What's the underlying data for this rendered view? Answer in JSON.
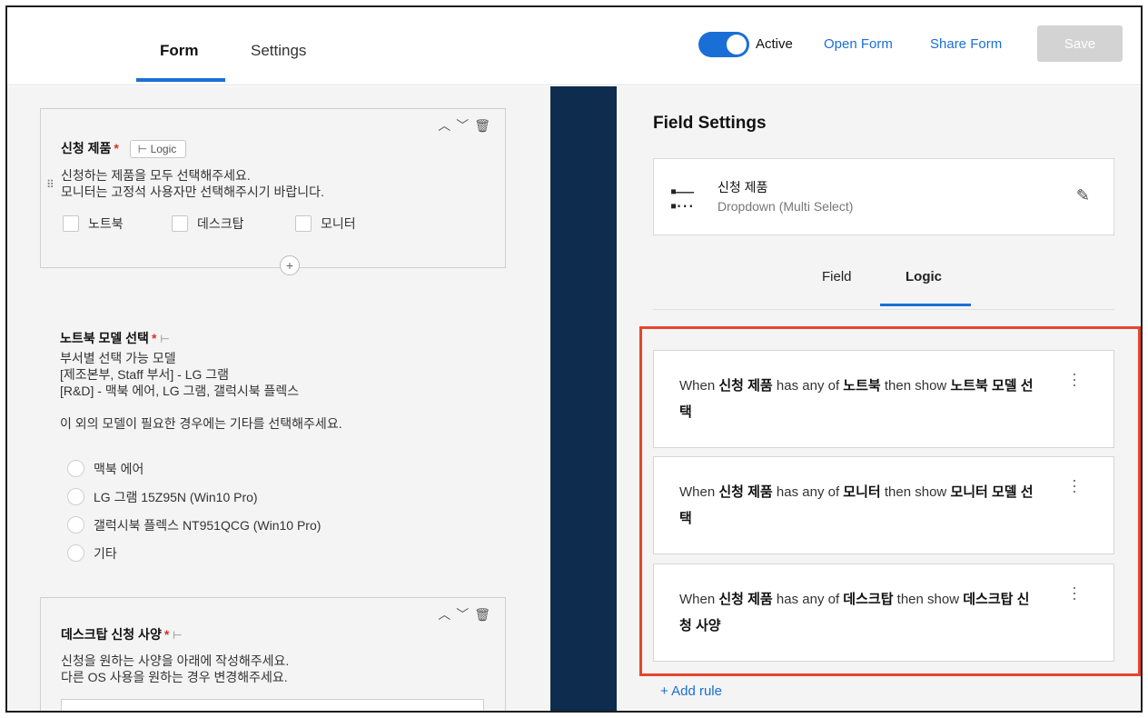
{
  "header": {
    "tabs": [
      {
        "label": "Form",
        "active": true
      },
      {
        "label": "Settings",
        "active": false
      }
    ],
    "active_toggle": {
      "on": true,
      "label": "Active"
    },
    "open_form": "Open Form",
    "share_form": "Share Form",
    "save": "Save"
  },
  "form": {
    "q1": {
      "title": "신청 제품",
      "logic_chip": "Logic",
      "description": "신청하는 제품을 모두 선택해주세요.\n모니터는 고정석 사용자만 선택해주시기 바랍니다.",
      "options": [
        "노트북",
        "데스크탑",
        "모니터"
      ]
    },
    "q2": {
      "title": "노트북 모델 선택",
      "description": "부서별 선택 가능 모델\n[제조본부, Staff 부서] - LG 그램\n[R&D] - 맥북 에어, LG 그램, 갤럭시북 플렉스\n\n이 외의 모델이 필요한 경우에는 기타를 선택해주세요.",
      "options": [
        "맥북 에어",
        "LG 그램 15Z95N (Win10 Pro)",
        "갤럭시북 플렉스 NT951QCG (Win10 Pro)",
        "기타"
      ]
    },
    "q3": {
      "title": "데스크탑 신청 사양",
      "description": "신청을 원하는 사양을 아래에 작성해주세요.\n다른 OS 사용을 원하는 경우 변경해주세요."
    }
  },
  "field_settings": {
    "title": "Field Settings",
    "field_name": "신청 제품",
    "field_type": "Dropdown (Multi Select)",
    "tabs": [
      "Field",
      "Logic"
    ],
    "rules": [
      {
        "w": "When",
        "field": "신청 제품",
        "h": "has any of",
        "value": "노트북",
        "t": "then show",
        "target": "노트북 모델 선택"
      },
      {
        "w": "When",
        "field": "신청 제품",
        "h": "has any of",
        "value": "모니터",
        "t": "then show",
        "target": "모니터 모델 선택"
      },
      {
        "w": "When",
        "field": "신청 제품",
        "h": "has any of",
        "value": "데스크탑",
        "t": "then show",
        "target": "데스크탑 신청 사양"
      }
    ],
    "add_rule": "+ Add rule"
  }
}
